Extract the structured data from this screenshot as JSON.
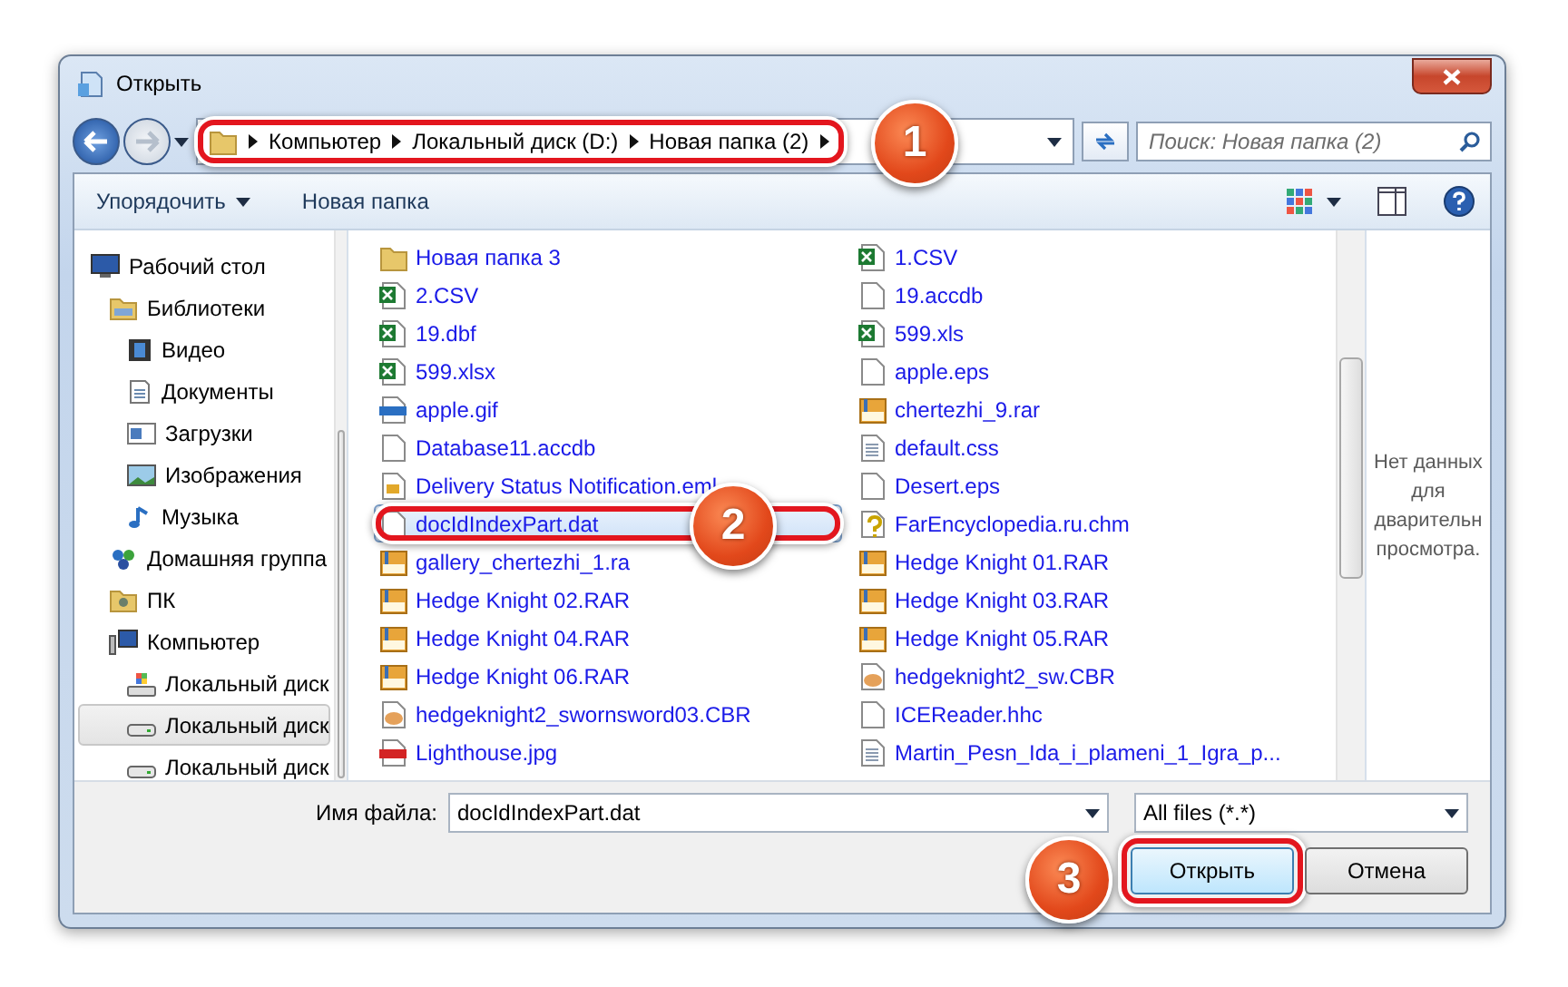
{
  "window": {
    "title": "Открыть"
  },
  "address": {
    "crumbs": [
      "Компьютер",
      "Локальный диск (D:)",
      "Новая папка (2)"
    ],
    "step": "1"
  },
  "search": {
    "placeholder": "Поиск: Новая папка (2)"
  },
  "toolbar": {
    "organize": "Упорядочить",
    "new_folder": "Новая папка"
  },
  "nav": [
    {
      "label": "Рабочий стол",
      "kind": "desktop",
      "selected": false,
      "children": [
        {
          "label": "Библиотеки",
          "kind": "library",
          "selected": false,
          "children": [
            {
              "label": "Видео",
              "kind": "video",
              "selected": false
            },
            {
              "label": "Документы",
              "kind": "docs",
              "selected": false
            },
            {
              "label": "Загрузки",
              "kind": "downloads",
              "selected": false
            },
            {
              "label": "Изображения",
              "kind": "pictures",
              "selected": false
            },
            {
              "label": "Музыка",
              "kind": "music",
              "selected": false
            }
          ]
        },
        {
          "label": "Домашняя группа",
          "kind": "homegroup",
          "selected": false
        },
        {
          "label": "ПК",
          "kind": "user",
          "selected": false
        },
        {
          "label": "Компьютер",
          "kind": "computer",
          "selected": false,
          "children": [
            {
              "label": "Локальный диск",
              "kind": "sysdrive",
              "selected": false
            },
            {
              "label": "Локальный диск",
              "kind": "drive",
              "selected": true
            },
            {
              "label": "Локальный диск",
              "kind": "drive",
              "selected": false
            }
          ]
        }
      ]
    }
  ],
  "files": [
    {
      "name": "Новая папка 3",
      "kind": "folder",
      "selected": false
    },
    {
      "name": "2.CSV",
      "kind": "sheet",
      "selected": false
    },
    {
      "name": "19.dbf",
      "kind": "sheet",
      "selected": false
    },
    {
      "name": "599.xlsx",
      "kind": "sheet",
      "selected": false
    },
    {
      "name": "apple.gif",
      "kind": "gif",
      "selected": false
    },
    {
      "name": "Database11.accdb",
      "kind": "blank",
      "selected": false
    },
    {
      "name": "Delivery Status Notification.eml",
      "kind": "mail",
      "selected": false
    },
    {
      "name": "docIdIndexPart.dat",
      "kind": "blank",
      "selected": true,
      "step": "2"
    },
    {
      "name": "gallery_chertezhi_1.ra",
      "kind": "rar",
      "selected": false
    },
    {
      "name": "Hedge Knight 02.RAR",
      "kind": "rar",
      "selected": false
    },
    {
      "name": "Hedge Knight 04.RAR",
      "kind": "rar",
      "selected": false
    },
    {
      "name": "Hedge Knight 06.RAR",
      "kind": "rar",
      "selected": false
    },
    {
      "name": "hedgeknight2_swornsword03.CBR",
      "kind": "paint",
      "selected": false
    },
    {
      "name": "Lighthouse.jpg",
      "kind": "jpg",
      "selected": false
    },
    {
      "name": "1.CSV",
      "kind": "sheet",
      "selected": false
    },
    {
      "name": "19.accdb",
      "kind": "blank",
      "selected": false
    },
    {
      "name": "599.xls",
      "kind": "sheet",
      "selected": false
    },
    {
      "name": "apple.eps",
      "kind": "blank",
      "selected": false
    },
    {
      "name": "chertezhi_9.rar",
      "kind": "rar",
      "selected": false
    },
    {
      "name": "default.css",
      "kind": "text",
      "selected": false
    },
    {
      "name": "Desert.eps",
      "kind": "blank",
      "selected": false
    },
    {
      "name": "FarEncyclopedia.ru.chm",
      "kind": "help",
      "selected": false
    },
    {
      "name": "Hedge Knight 01.RAR",
      "kind": "rar",
      "selected": false
    },
    {
      "name": "Hedge Knight 03.RAR",
      "kind": "rar",
      "selected": false
    },
    {
      "name": "Hedge Knight 05.RAR",
      "kind": "rar",
      "selected": false
    },
    {
      "name": "hedgeknight2_sw.CBR",
      "kind": "paint",
      "selected": false
    },
    {
      "name": "ICEReader.hhc",
      "kind": "blank",
      "selected": false
    },
    {
      "name": "Martin_Pesn_Ida_i_plameni_1_Igra_p...",
      "kind": "text",
      "selected": false
    }
  ],
  "preview": {
    "lines": [
      "Нет данных",
      "для",
      "дварительн",
      "просмотра."
    ]
  },
  "filename": {
    "label": "Имя файла:",
    "value": "docIdIndexPart.dat"
  },
  "filter": {
    "value": "All files (*.*)"
  },
  "buttons": [
    {
      "label": "Открыть",
      "kind": "primary",
      "step": "3"
    },
    {
      "label": "Отмена",
      "kind": "normal"
    }
  ]
}
